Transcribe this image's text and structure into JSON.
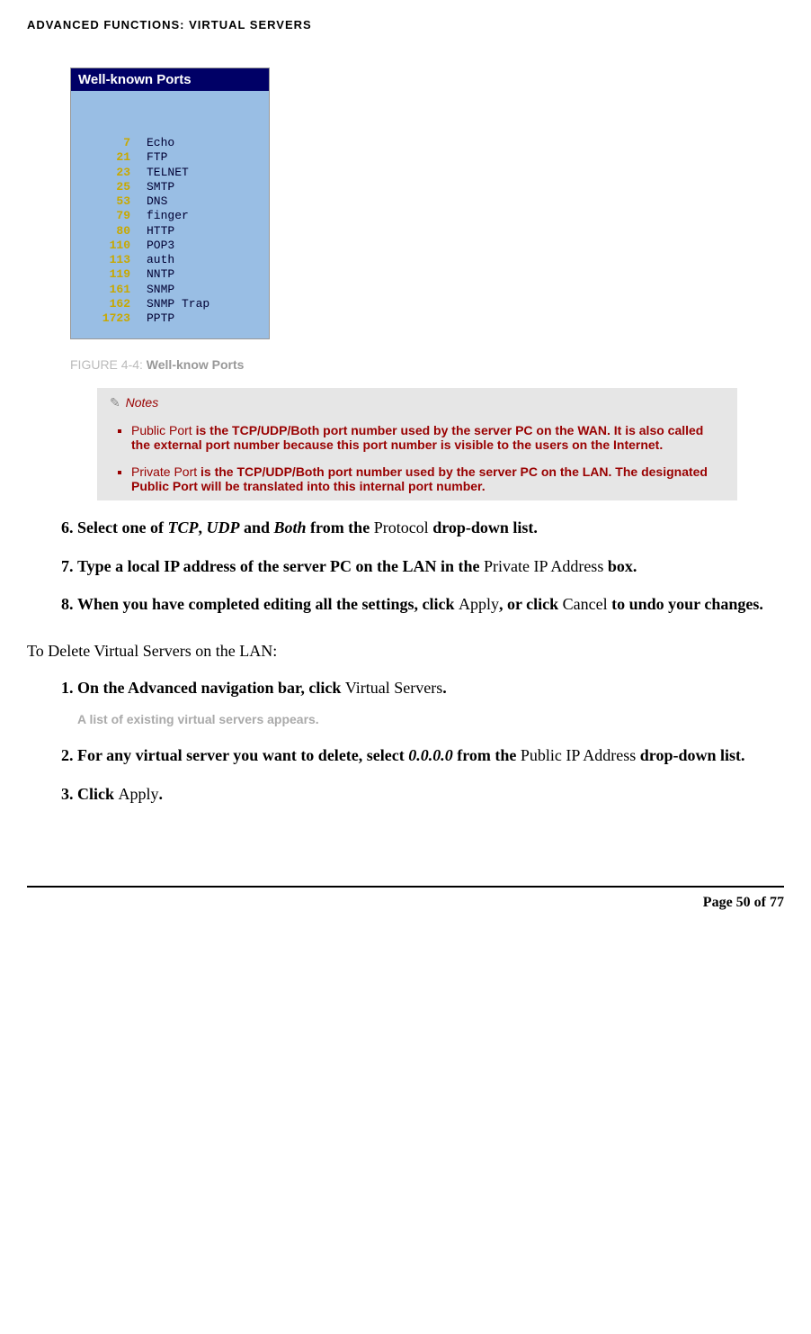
{
  "header": "ADVANCED FUNCTIONS: VIRTUAL SERVERS",
  "ports": {
    "title": "Well-known Ports",
    "rows": [
      {
        "num": "7",
        "name": "Echo"
      },
      {
        "num": "21",
        "name": "FTP"
      },
      {
        "num": "23",
        "name": "TELNET"
      },
      {
        "num": "25",
        "name": "SMTP"
      },
      {
        "num": "53",
        "name": "DNS"
      },
      {
        "num": "79",
        "name": "finger"
      },
      {
        "num": "80",
        "name": "HTTP"
      },
      {
        "num": "110",
        "name": "POP3"
      },
      {
        "num": "113",
        "name": "auth"
      },
      {
        "num": "119",
        "name": "NNTP"
      },
      {
        "num": "161",
        "name": "SNMP"
      },
      {
        "num": "162",
        "name": "SNMP Trap"
      },
      {
        "num": "1723",
        "name": "PPTP"
      }
    ]
  },
  "figure_caption": {
    "label": "FIGURE 4-4: ",
    "title": "Well-know Ports"
  },
  "notes": {
    "header": "Notes",
    "items": [
      {
        "term": "Public Port",
        "rest": " is the TCP/UDP/Both port number used by the server PC on the WAN. It is also called the external port number because this port number is visible to the users on the Internet."
      },
      {
        "term": "Private Port",
        "rest": " is the TCP/UDP/Both port number used by the server PC on the LAN. The designated Public Port will be translated into this internal port number."
      }
    ]
  },
  "steps_a": [
    {
      "pre": "Select one of ",
      "italic": "TCP",
      "mid1": ", ",
      "italic2": "UDP",
      "mid2": " and ",
      "italic3": "Both",
      "mid3": " from the ",
      "normal": "Protocol",
      "post": " drop-down list."
    },
    {
      "pre": "Type a local IP address of the server PC on the LAN in the ",
      "normal": "Private IP Address",
      "post": " box."
    },
    {
      "pre": "When you have completed editing all the settings, click ",
      "normal": "Apply",
      "mid": ", or click ",
      "normal2": "Cancel",
      "post": " to undo your changes."
    }
  ],
  "section2_title": "To Delete Virtual Servers on the LAN:",
  "steps_b": [
    {
      "pre": "On the Advanced navigation bar, click ",
      "normal": "Virtual Servers",
      "post": ".",
      "subnote": "A list of existing virtual servers appears."
    },
    {
      "pre": "For any virtual server you want to delete, select ",
      "italic": "0.0.0.0",
      "mid": " from the ",
      "normal": "Public IP Address",
      "post": " drop-down list."
    },
    {
      "pre": "Click ",
      "normal": "Apply",
      "post": "."
    }
  ],
  "footer": "Page 50 of 77"
}
